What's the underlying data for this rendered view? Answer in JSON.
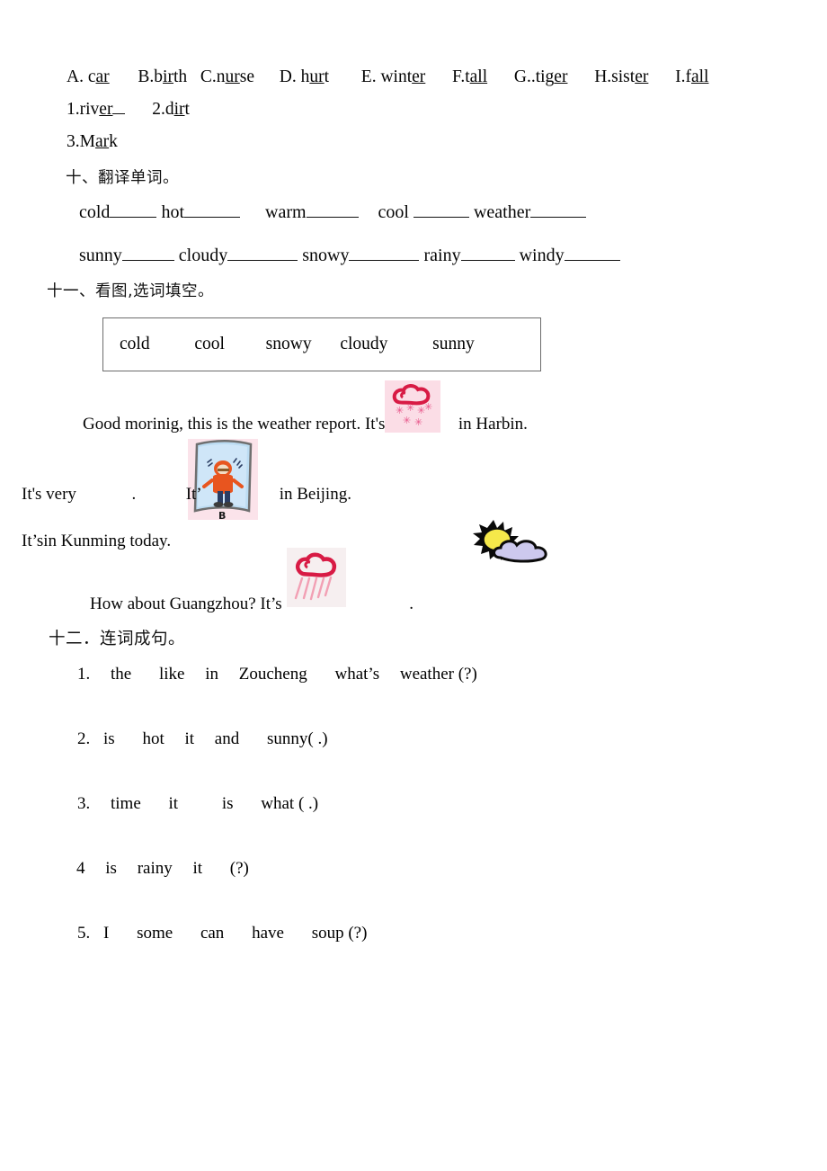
{
  "document": {
    "page_background": "#ffffff",
    "text_color": "#050505"
  },
  "phonics_exercise": {
    "options_line": {
      "items": [
        {
          "label": "A. c",
          "underlined": "ar",
          "tail": ""
        },
        {
          "label": "B.b",
          "underlined": "ir",
          "tail": "th"
        },
        {
          "label": "C.n",
          "underlined": "ur",
          "tail": "se"
        },
        {
          "label": "D. h",
          "underlined": "ur",
          "tail": "t"
        },
        {
          "label": "E. wint",
          "underlined": "er",
          "tail": ""
        },
        {
          "label": "F.t",
          "underlined": "all",
          "tail": ""
        },
        {
          "label": "G..tig",
          "underlined": "er",
          "tail": ""
        },
        {
          "label": "H.sist",
          "underlined": "er",
          "tail": ""
        },
        {
          "label": "I.f",
          "underlined": "all",
          "tail": ""
        }
      ]
    },
    "answers_line_1": [
      {
        "label": "1.riv",
        "underlined": "er",
        "tail": "",
        "blank": true
      },
      {
        "label": "2.d",
        "underlined": "ir",
        "tail": "t",
        "blank": false
      }
    ],
    "answers_line_2": [
      {
        "label": "3.M",
        "underlined": "ar",
        "tail": "k",
        "blank": false
      }
    ]
  },
  "section_ten": {
    "heading": "十、翻译单词。",
    "row1": [
      {
        "word": "cold",
        "blank_width": 52
      },
      {
        "word": "hot",
        "blank_width": 62
      },
      {
        "word": "warm",
        "blank_width": 58
      },
      {
        "word": "cool ",
        "blank_width": 62
      },
      {
        "word": "weather",
        "blank_width": 62
      }
    ],
    "row2": [
      {
        "word": "sunny",
        "blank_width": 58
      },
      {
        "word": "cloudy",
        "blank_width": 78
      },
      {
        "word": "snowy",
        "blank_width": 78
      },
      {
        "word": "rainy",
        "blank_width": 60
      },
      {
        "word": "windy",
        "blank_width": 62
      }
    ]
  },
  "section_eleven": {
    "heading": "十一、看图,选词填空。",
    "word_bank": {
      "words": [
        "cold",
        "cool",
        "snowy",
        "cloudy",
        "sunny"
      ],
      "gaps": [
        0,
        40,
        36,
        28,
        44
      ],
      "border_color": "#6c6c6c"
    },
    "report": {
      "line1_before": "Good morinig, this is the weather report. It's",
      "line1_after": "in Harbin.",
      "line2_before": "It's very",
      "line2_mid": ".",
      "line2_after_pic_before": "It’",
      "line2_after": "in Beijing.",
      "line3": "It’sin Kunming today.",
      "line4_before": "How about Guangzhou? It’s",
      "line4_after": "."
    },
    "icons": {
      "snow": {
        "name": "snowy-weather-clipart",
        "bg": "#fbdde6",
        "cloud": "#d81b45",
        "flake": "#e8558a"
      },
      "beijing": {
        "name": "cold-person-clipart",
        "bg": "#fbe3ea",
        "card": "#bcdcf2",
        "coat": "#e8551f",
        "letter": "B"
      },
      "suncloud": {
        "name": "sunny-cloudy-clipart",
        "sun": "#f5e84a",
        "cloud": "#cdc9ee",
        "outline": "#000000"
      },
      "rain": {
        "name": "rainy-weather-clipart",
        "bg": "#f6eff0",
        "cloud": "#d81b45",
        "streak": "#f2a0b4"
      }
    }
  },
  "section_twelve": {
    "heading": "十二．连词成句。",
    "items": [
      {
        "number": "1.",
        "words": [
          "the",
          "like",
          "in",
          "Zoucheng",
          "what’s",
          "weather (?)"
        ]
      },
      {
        "number": "2.",
        "words": [
          "is",
          "hot",
          "it",
          "and",
          "sunny( .)"
        ]
      },
      {
        "number": "3.",
        "words": [
          "time",
          "it",
          "is",
          "what ( .)"
        ]
      },
      {
        "number": "4",
        "words": [
          "is",
          "rainy",
          "it",
          "(?)"
        ]
      },
      {
        "number": "5.",
        "words": [
          "I",
          "some",
          "can",
          "have",
          "soup (?)"
        ]
      }
    ]
  }
}
